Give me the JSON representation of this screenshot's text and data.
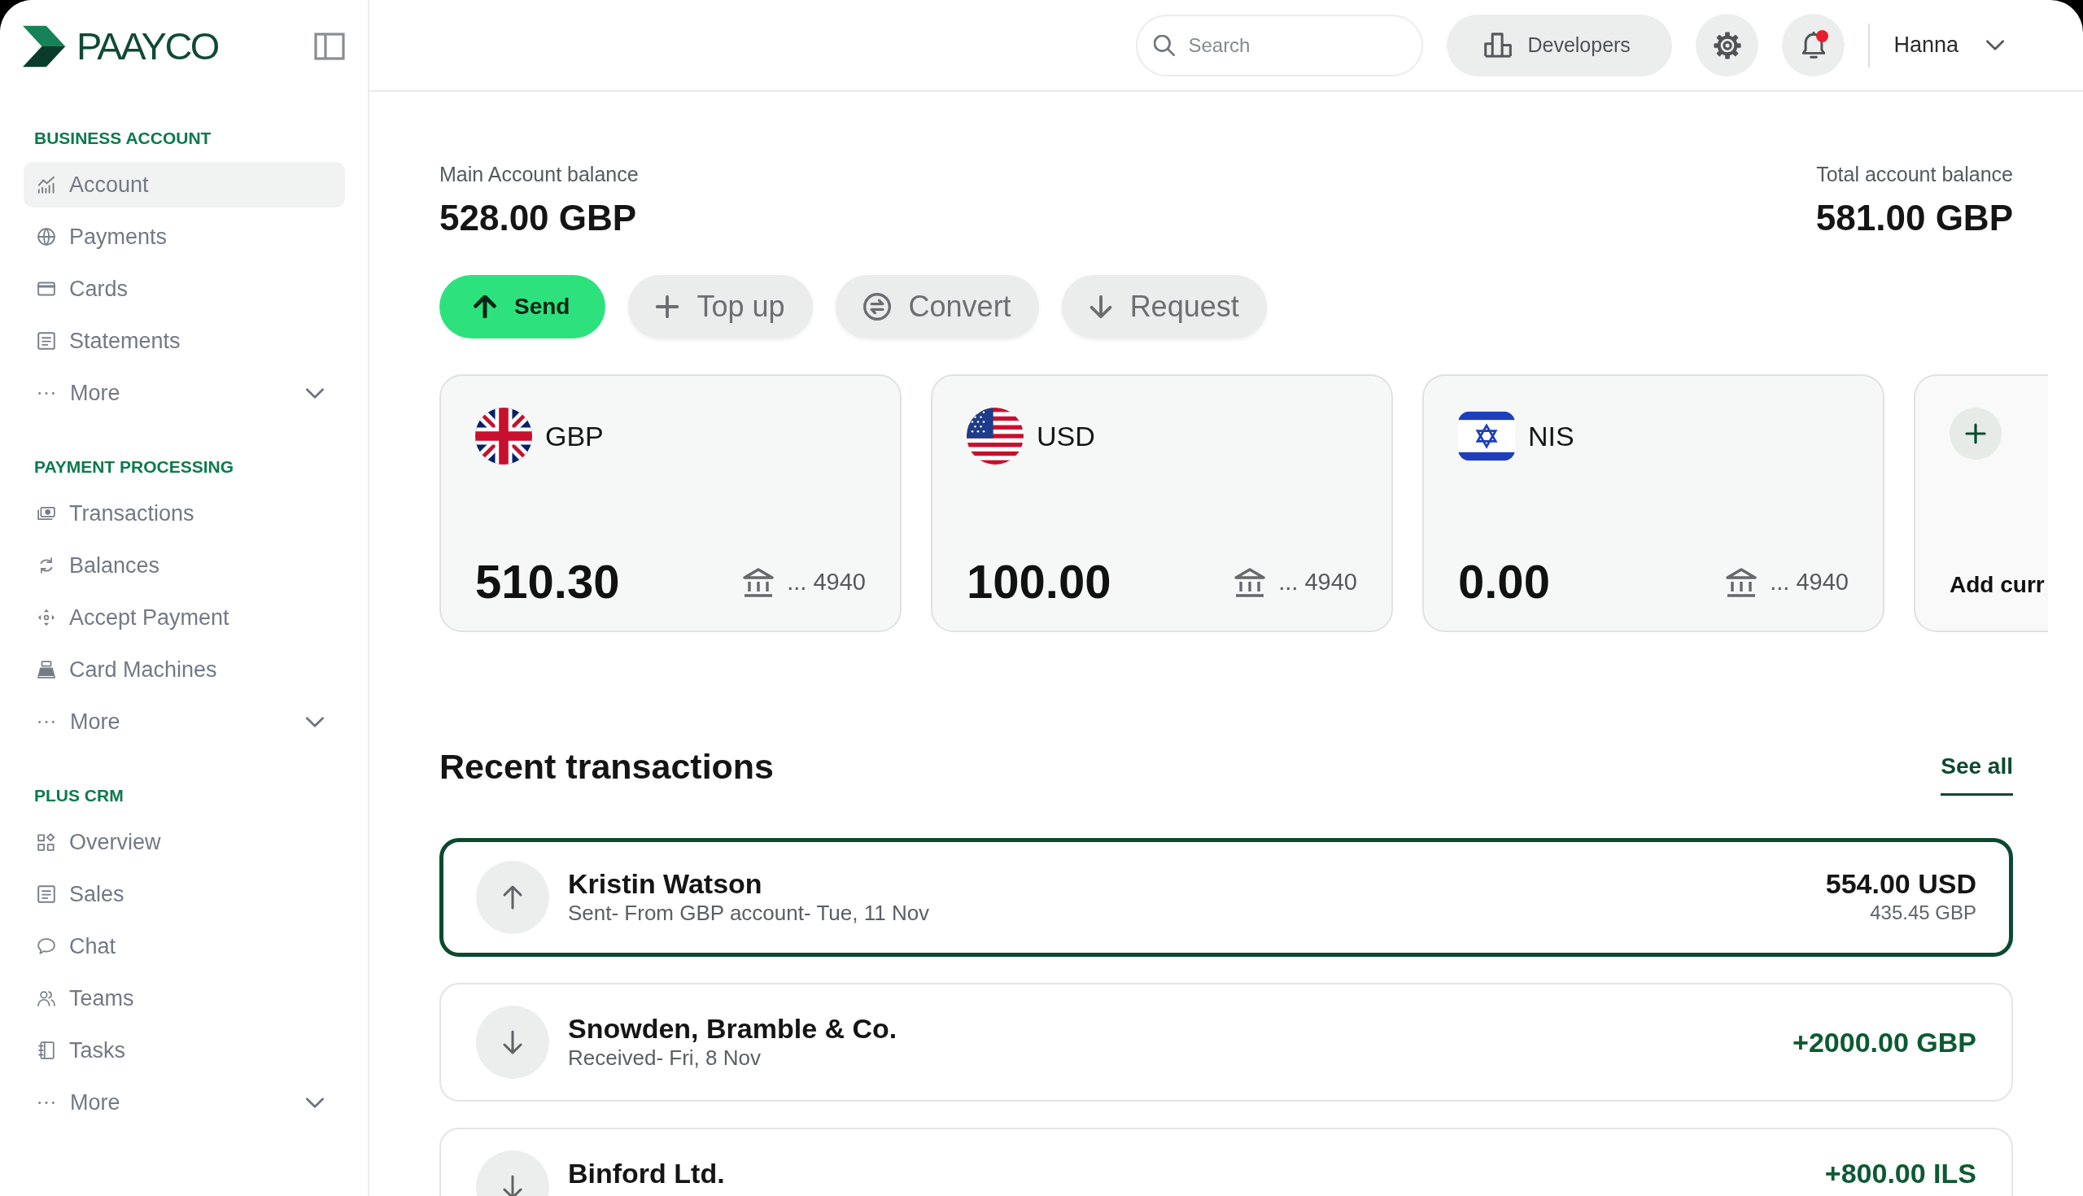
{
  "sidebar": {
    "brand": "PAAYCO",
    "sections": [
      {
        "title": "BUSINESS ACCOUNT",
        "items": [
          {
            "label": "Account",
            "selected": true
          },
          {
            "label": "Payments",
            "selected": false
          },
          {
            "label": "Cards",
            "selected": false
          },
          {
            "label": "Statements",
            "selected": false
          }
        ],
        "more": {
          "label": "More",
          "expanded": false
        }
      },
      {
        "title": "PAYMENT PROCESSING",
        "items": [
          {
            "label": "Transactions",
            "selected": false
          },
          {
            "label": "Balances",
            "selected": false
          },
          {
            "label": "Accept Payment",
            "selected": false
          },
          {
            "label": "Card Machines",
            "selected": false
          }
        ],
        "more": {
          "label": "More",
          "expanded": false
        }
      },
      {
        "title": "PLUS CRM",
        "items": [
          {
            "label": "Overview",
            "selected": false
          },
          {
            "label": "Sales",
            "selected": false
          },
          {
            "label": "Chat",
            "selected": false
          },
          {
            "label": "Teams",
            "selected": false
          },
          {
            "label": "Tasks",
            "selected": false
          }
        ],
        "more": {
          "label": "More",
          "expanded": false
        }
      }
    ]
  },
  "topbar": {
    "search": {
      "placeholder": "Search"
    },
    "developers_button": "Developers",
    "notifications": {
      "unread": true
    },
    "user": "Hanna"
  },
  "balances": {
    "main": {
      "label": "Main Account balance",
      "amount": "528.00 GBP"
    },
    "total": {
      "label": "Total account balance",
      "amount": "581.00 GBP"
    }
  },
  "actions": [
    {
      "label": "Send",
      "kind": "primary"
    },
    {
      "label": "Top up",
      "kind": "secondary"
    },
    {
      "label": "Convert",
      "kind": "secondary"
    },
    {
      "label": "Request",
      "kind": "secondary"
    }
  ],
  "accounts": [
    {
      "kind": "uk",
      "currency": "GBP",
      "amount": "510.30",
      "account": "... 4940"
    },
    {
      "kind": "us",
      "currency": "USD",
      "amount": "100.00",
      "account": "... 4940"
    },
    {
      "kind": "israel",
      "currency": "NIS",
      "amount": "0.00",
      "account": "... 4940"
    }
  ],
  "add_currency": {
    "label": "Add curr"
  },
  "transactions": {
    "title": "Recent transactions",
    "see_all": "See all",
    "rows": [
      {
        "kind": "sent",
        "name": "Kristin Watson",
        "details": "Sent- From GBP account- Tue, 11 Nov",
        "amount": "554.00 USD",
        "converted": "435.45 GBP",
        "selected": true
      },
      {
        "kind": "received",
        "name": "Snowden, Bramble & Co.",
        "details": "Received- Fri, 8 Nov",
        "amount": "+2000.00 GBP",
        "selected": false
      },
      {
        "kind": "received",
        "name": "Binford Ltd.",
        "amount": "+800.00 ILS",
        "selected": false
      }
    ]
  }
}
